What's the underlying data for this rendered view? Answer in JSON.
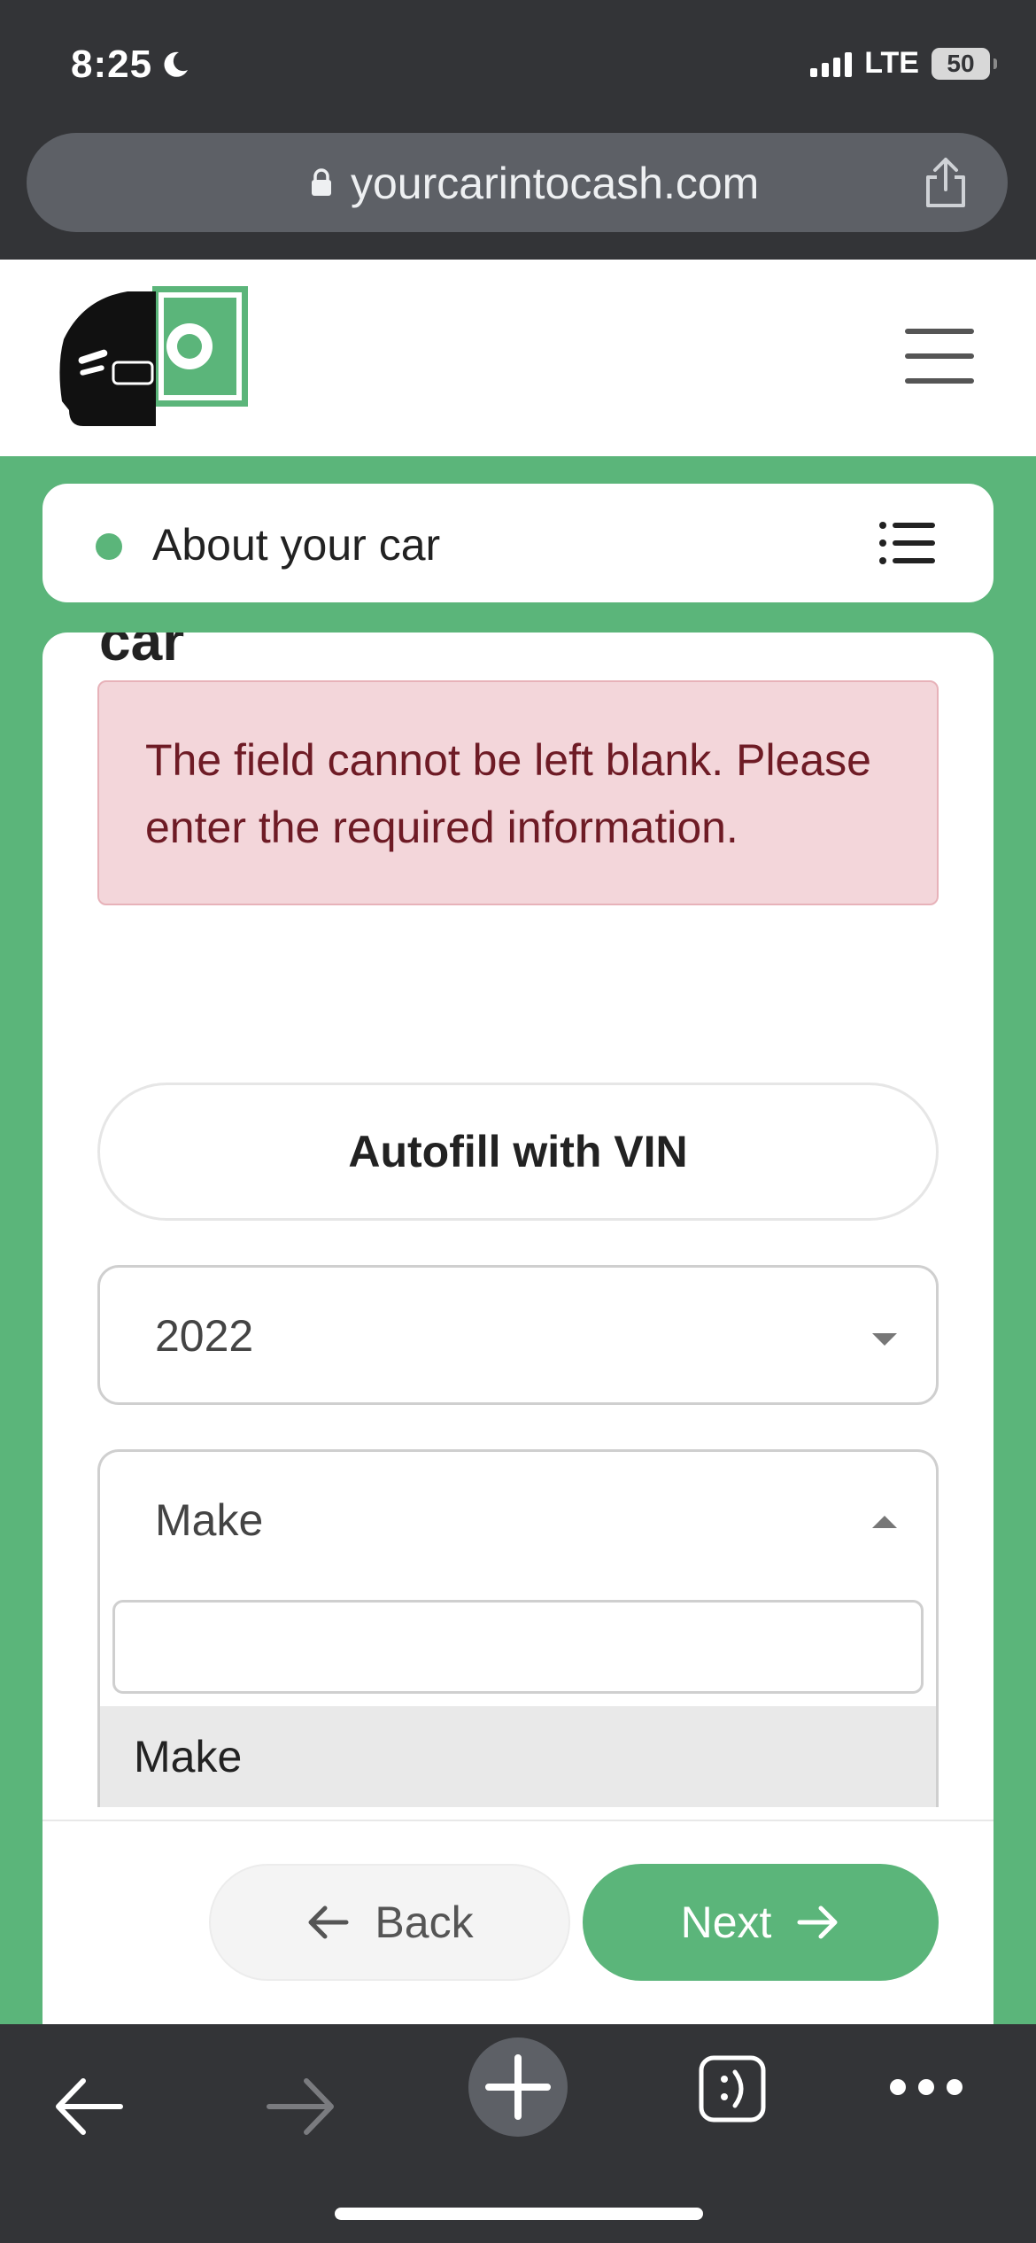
{
  "status_bar": {
    "time": "8:25",
    "network": "LTE",
    "battery": "50"
  },
  "browser": {
    "url": "yourcarintocash.com"
  },
  "site": {
    "step_label": "About your car",
    "heading_fragment": "car"
  },
  "form": {
    "error_message": "The field cannot be left blank. Please enter the required information.",
    "autofill_button": "Autofill with VIN",
    "year_select": {
      "value": "2022"
    },
    "make_select": {
      "value": "Make",
      "search_value": "",
      "options": [
        "Make"
      ]
    },
    "back_button": "Back",
    "next_button": "Next"
  },
  "colors": {
    "brand_green": "#5bb57a",
    "error_bg": "#f3d6da",
    "error_text": "#6e1b25",
    "browser_chrome": "#333437"
  },
  "icons": {
    "status": [
      "moon-icon",
      "signal-icon",
      "battery-icon"
    ],
    "browser": [
      "lock-icon",
      "share-icon"
    ],
    "toolbar": [
      "back-arrow-icon",
      "forward-arrow-icon",
      "new-tab-plus-icon",
      "tabs-icon",
      "more-dots-icon"
    ]
  }
}
